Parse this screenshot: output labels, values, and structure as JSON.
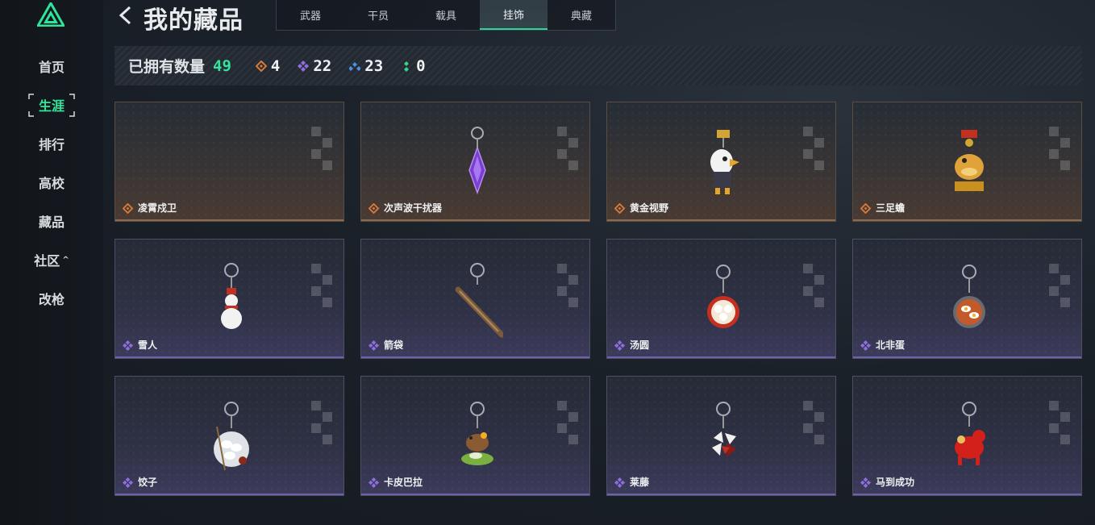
{
  "sidebar": {
    "items": [
      {
        "label": "首页",
        "active": false
      },
      {
        "label": "生涯",
        "active": true
      },
      {
        "label": "排行",
        "active": false
      },
      {
        "label": "高校",
        "active": false
      },
      {
        "label": "藏品",
        "active": false
      },
      {
        "label": "社区",
        "active": false,
        "caret": "^"
      },
      {
        "label": "改枪",
        "active": false
      }
    ]
  },
  "header": {
    "title": "我的藏品",
    "tabs": [
      {
        "label": "武器",
        "active": false
      },
      {
        "label": "干员",
        "active": false
      },
      {
        "label": "载具",
        "active": false
      },
      {
        "label": "挂饰",
        "active": true
      },
      {
        "label": "典藏",
        "active": false
      }
    ]
  },
  "stats": {
    "owned_label": "已拥有数量",
    "owned_count": "49",
    "counts": [
      {
        "icon": "orange-diamond-icon",
        "color": "#d9793a",
        "value": "4"
      },
      {
        "icon": "purple-diamond-icon",
        "color": "#8f6ee0",
        "value": "22"
      },
      {
        "icon": "blue-diamond-icon",
        "color": "#4f8fe0",
        "value": "23"
      },
      {
        "icon": "green-diamond-icon",
        "color": "#3ad28a",
        "value": "0"
      }
    ]
  },
  "items": [
    {
      "name": "凌霄戍卫",
      "rarity": "orange",
      "icon": "empty"
    },
    {
      "name": "次声波干扰器",
      "rarity": "orange",
      "icon": "crystal-charm-icon"
    },
    {
      "name": "黄金视野",
      "rarity": "orange",
      "icon": "eagle-charm-icon"
    },
    {
      "name": "三足蟾",
      "rarity": "orange",
      "icon": "toad-charm-icon"
    },
    {
      "name": "雪人",
      "rarity": "purple",
      "icon": "snowman-charm-icon"
    },
    {
      "name": "箭袋",
      "rarity": "purple",
      "icon": "quiver-charm-icon"
    },
    {
      "name": "汤圆",
      "rarity": "purple",
      "icon": "tangyuan-charm-icon"
    },
    {
      "name": "北非蛋",
      "rarity": "purple",
      "icon": "shakshuka-charm-icon"
    },
    {
      "name": "饺子",
      "rarity": "purple",
      "icon": "dumpling-charm-icon"
    },
    {
      "name": "卡皮巴拉",
      "rarity": "purple",
      "icon": "capybara-charm-icon"
    },
    {
      "name": "莱藤",
      "rarity": "purple",
      "icon": "flower-charm-icon"
    },
    {
      "name": "马到成功",
      "rarity": "purple",
      "icon": "horse-charm-icon"
    }
  ],
  "colors": {
    "accent": "#33e59a",
    "orange_rarity": "#d9793a",
    "purple_rarity": "#8f6ee0"
  }
}
